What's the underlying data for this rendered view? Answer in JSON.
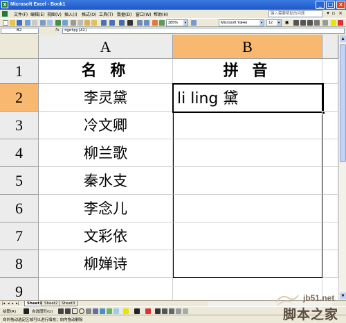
{
  "window": {
    "title": "Microsoft Excel - Book1"
  },
  "menu": {
    "items": [
      "文件(F)",
      "编辑(E)",
      "视图(V)",
      "插入(I)",
      "格式(O)",
      "工具(T)",
      "数据(D)",
      "窗口(W)",
      "帮助(H)"
    ],
    "help_placeholder": "键入需要帮助的问题"
  },
  "toolbar": {
    "zoom": "385%",
    "font_name": "Microsoft YaHei",
    "font_size": "12",
    "bold_label": "B"
  },
  "formula_bar": {
    "name_box": "B2",
    "fx_label": "fx",
    "formula": "=getpy(A2)"
  },
  "grid": {
    "columns": [
      "A",
      "B"
    ],
    "rows": [
      "1",
      "2",
      "3",
      "4",
      "5",
      "6",
      "7",
      "8",
      "9"
    ],
    "header_a": "名 称",
    "header_b": "拼 音",
    "names": [
      "李灵黛",
      "冷文卿",
      "柳兰歌",
      "秦水支",
      "李念儿",
      "文彩依",
      "柳婵诗"
    ],
    "pinyin_b2": "li ling 黛",
    "active_cell": "B2"
  },
  "sheet_tabs": [
    "Sheet1",
    "Sheet2",
    "Sheet3"
  ],
  "drawing_toolbar": {
    "draw_label": "绘图(R)",
    "autoshapes_label": "自选图形(U)"
  },
  "status": {
    "text": "向外拖动选定区域可以进行填充；向内拖动删除"
  },
  "watermark": {
    "url": "jb51.net",
    "name": "脚本之家"
  },
  "colors": {
    "active_header": "#f8b870",
    "title_bar": "#1f57c8",
    "excel_green": "#1e7b34"
  }
}
